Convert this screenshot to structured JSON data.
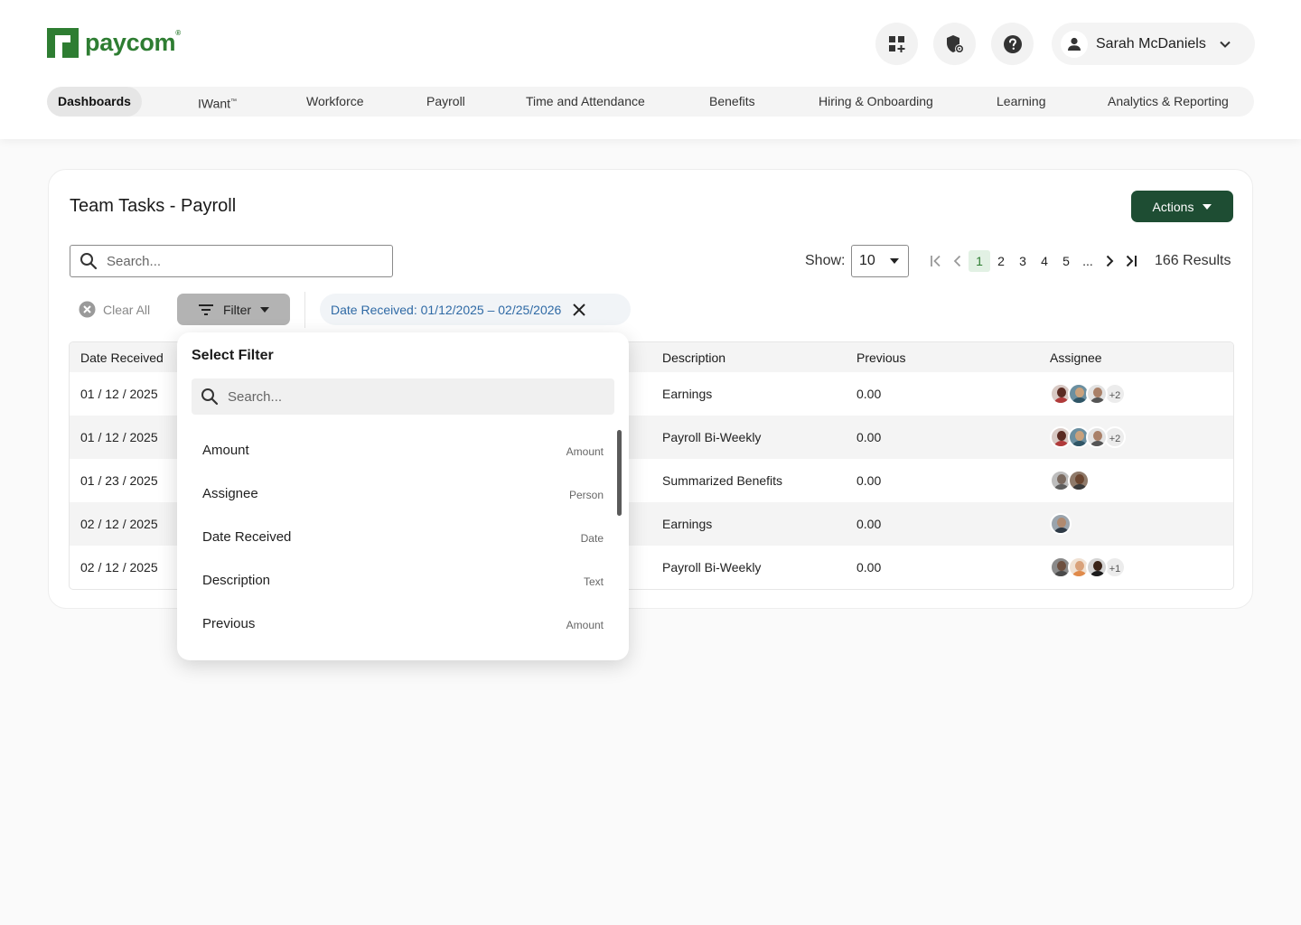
{
  "header": {
    "logo_text": "paycom",
    "logo_mark": "®",
    "user_name": "Sarah McDaniels",
    "icons": [
      "apps-add-icon",
      "shield-gear-icon",
      "help-icon",
      "user-icon",
      "chevron-down-icon"
    ]
  },
  "nav": {
    "items": [
      {
        "label": "Dashboards",
        "active": true
      },
      {
        "label": "IWant",
        "sup": "™"
      },
      {
        "label": "Workforce"
      },
      {
        "label": "Payroll"
      },
      {
        "label": "Time and Attendance"
      },
      {
        "label": "Benefits"
      },
      {
        "label": "Hiring & Onboarding"
      },
      {
        "label": "Learning"
      },
      {
        "label": "Analytics & Reporting"
      }
    ]
  },
  "card": {
    "title": "Team Tasks - Payroll",
    "actions_label": "Actions",
    "search_placeholder": "Search...",
    "show_label": "Show:",
    "show_value": "10",
    "pages": [
      "1",
      "2",
      "3",
      "4",
      "5",
      "..."
    ],
    "active_page": "1",
    "results": "166 Results",
    "clear_all": "Clear All",
    "filter_label": "Filter",
    "chip_label": "Date Received: 01/12/2025 – 02/25/2026"
  },
  "table": {
    "columns": [
      "Date Received",
      "Description",
      "Previous",
      "Assignee"
    ],
    "rows": [
      {
        "date": "01 / 12 / 2025",
        "description": "Earnings",
        "previous": "0.00",
        "more": "+2"
      },
      {
        "date": "01 / 12 / 2025",
        "description": "Payroll Bi-Weekly",
        "previous": "0.00",
        "more": "+2"
      },
      {
        "date": "01 / 23 / 2025",
        "description": "Summarized Benefits",
        "previous": "0.00",
        "more": ""
      },
      {
        "date": "02 / 12 / 2025",
        "description": "Earnings",
        "previous": "0.00",
        "more": ""
      },
      {
        "date": "02 / 12 / 2025",
        "description": "Payroll Bi-Weekly",
        "previous": "0.00",
        "more": "+1"
      }
    ]
  },
  "dropdown": {
    "title": "Select Filter",
    "search_placeholder": "Search...",
    "items": [
      {
        "label": "Amount",
        "type": "Amount"
      },
      {
        "label": "Assignee",
        "type": "Person"
      },
      {
        "label": "Date Received",
        "type": "Date"
      },
      {
        "label": "Description",
        "type": "Text"
      },
      {
        "label": "Previous",
        "type": "Amount"
      }
    ]
  },
  "colors": {
    "brand_green": "#2e7d32",
    "actions_bg": "#1e4d33",
    "chip_text": "#2f6aa5",
    "active_page_bg": "#e2f1e4"
  }
}
